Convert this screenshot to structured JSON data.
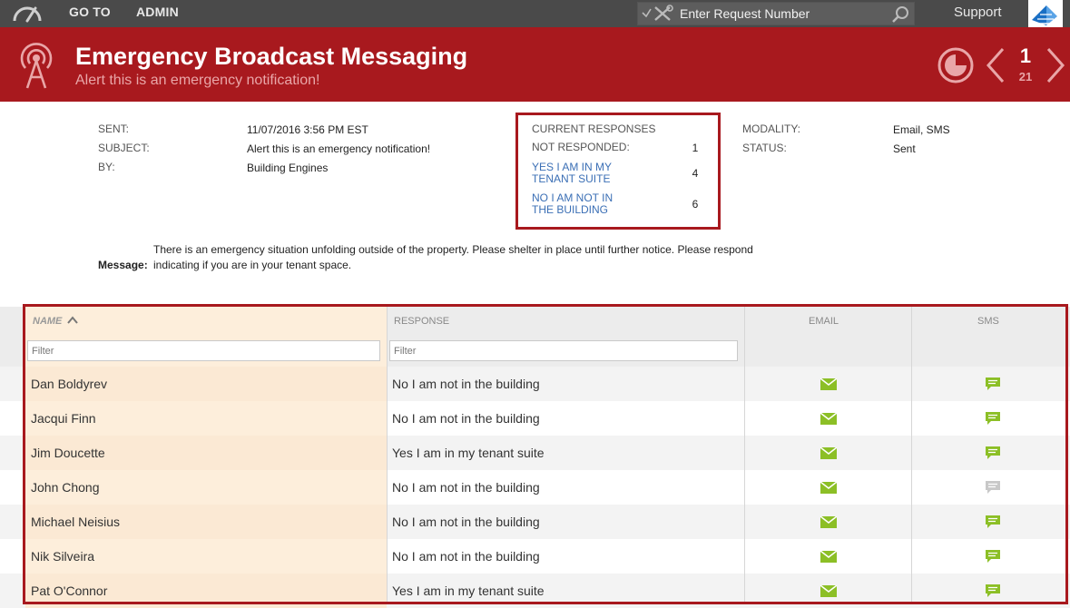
{
  "topbar": {
    "nav": [
      "GO TO",
      "ADMIN"
    ],
    "search_placeholder": "Enter Request Number",
    "support": "Support"
  },
  "header": {
    "title": "Emergency Broadcast Messaging",
    "subtitle": "Alert this is an emergency notification!",
    "page_current": "1",
    "page_total": "21"
  },
  "details": {
    "sent_label": "SENT:",
    "sent_value": "11/07/2016 3:56 PM EST",
    "subject_label": "SUBJECT:",
    "subject_value": "Alert this is an emergency notification!",
    "by_label": "BY:",
    "by_value": "Building Engines",
    "modality_label": "MODALITY:",
    "modality_value": "Email, SMS",
    "status_label": "STATUS:",
    "status_value": "Sent"
  },
  "responses": {
    "heading": "CURRENT RESPONSES",
    "not_responded_label": "NOT RESPONDED:",
    "not_responded_count": "1",
    "yes_line1": "YES I AM IN MY",
    "yes_line2": "TENANT SUITE",
    "yes_count": "4",
    "no_line1": "NO I AM NOT IN",
    "no_line2": "THE BUILDING",
    "no_count": "6"
  },
  "message": {
    "line1": "There is an emergency situation unfolding outside of the property. Please shelter in place until further notice. Please respond",
    "label": "Message:",
    "line2": "indicating if you are in your tenant space."
  },
  "grid": {
    "columns": {
      "name": "NAME",
      "response": "RESPONSE",
      "email": "EMAIL",
      "sms": "SMS"
    },
    "filter_placeholder": "Filter",
    "colors": {
      "delivered": "#8cbf26",
      "undelivered": "#c8c8c8"
    },
    "rows": [
      {
        "name": "Dan Boldyrev",
        "response": "No I am not in the building",
        "email": "delivered",
        "sms": "delivered"
      },
      {
        "name": "Jacqui Finn",
        "response": "No I am not in the building",
        "email": "delivered",
        "sms": "delivered"
      },
      {
        "name": "Jim Doucette",
        "response": "Yes I am in my tenant suite",
        "email": "delivered",
        "sms": "delivered"
      },
      {
        "name": "John Chong",
        "response": "No I am not in the building",
        "email": "delivered",
        "sms": "undelivered"
      },
      {
        "name": "Michael Neisius",
        "response": "No I am not in the building",
        "email": "delivered",
        "sms": "delivered"
      },
      {
        "name": "Nik Silveira",
        "response": "No I am not in the building",
        "email": "delivered",
        "sms": "delivered"
      },
      {
        "name": "Pat O'Connor",
        "response": "Yes I am in my tenant suite",
        "email": "delivered",
        "sms": "delivered"
      }
    ]
  }
}
